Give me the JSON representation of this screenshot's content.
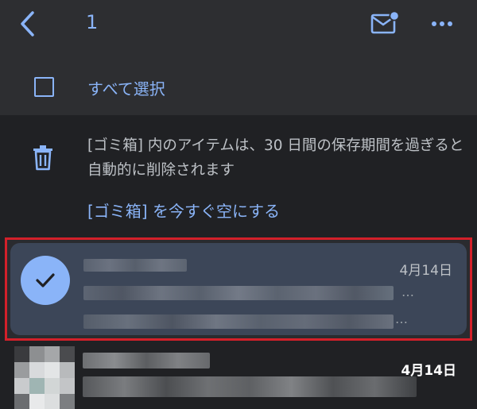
{
  "header": {
    "selected_count": "1",
    "back_icon": "chevron-left-icon",
    "mark_unread_icon": "mail-unread-icon",
    "more_icon": "more-horizontal-icon"
  },
  "select_all": {
    "label": "すべて選択"
  },
  "trash": {
    "notice": "[ゴミ箱] 内のアイテムは、30 日間の保存期間を過ぎると自動的に削除されます",
    "empty_now_link": "[ゴミ箱] を今すぐ空にする"
  },
  "messages": [
    {
      "date": "4月14日",
      "selected": true,
      "unread": false,
      "ellipsis": "…"
    },
    {
      "date": "4月14日",
      "selected": false,
      "unread": true
    }
  ],
  "colors": {
    "accent": "#8ab4f8",
    "highlight_border": "#d3202a",
    "selected_row_bg": "#3c4658",
    "toolbar_bg": "#2d2e31",
    "background": "#202124"
  }
}
